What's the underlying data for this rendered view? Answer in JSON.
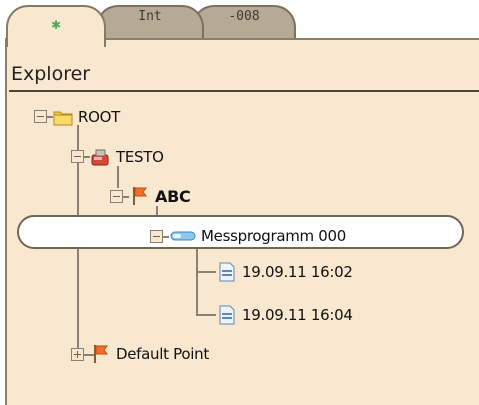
{
  "tabs": [
    {
      "label": "",
      "icon": "green-star-icon",
      "active": true
    },
    {
      "label": "Int",
      "active": false
    },
    {
      "label": "-008",
      "active": false
    }
  ],
  "panel": {
    "title": "Explorer"
  },
  "tree": [
    {
      "label": "ROOT",
      "icon": "folder-icon",
      "expanded": true
    },
    {
      "label": "TESTO",
      "icon": "device-icon",
      "expanded": true
    },
    {
      "label": "ABC",
      "icon": "red-flag-icon",
      "expanded": true,
      "bold": true
    },
    {
      "label": "Messprogramm 000",
      "icon": "program-pill-icon",
      "expanded": true,
      "selected": true
    },
    {
      "label": "19.09.11 16:02",
      "icon": "document-icon"
    },
    {
      "label": "19.09.11 16:04",
      "icon": "document-icon"
    },
    {
      "label": "Default Point",
      "icon": "red-flag-icon",
      "expanded": false
    }
  ],
  "colors": {
    "panel_bg": "#f8e8cf",
    "tab_bg": "#b7aa94",
    "line": "#8a8174"
  }
}
